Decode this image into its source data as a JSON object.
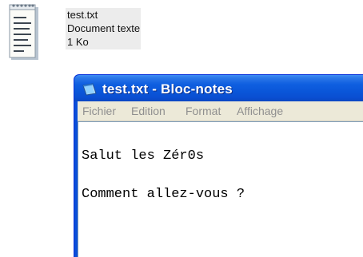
{
  "desktop_file": {
    "icon": "text-document-icon",
    "name": "test.txt",
    "type": "Document texte",
    "size": "1 Ko"
  },
  "notepad": {
    "title": "test.txt - Bloc-notes",
    "title_icon": "notepad-icon",
    "menu": {
      "file": "Fichier",
      "edit": "Edition",
      "format": "Format",
      "view": "Affichage"
    },
    "content_lines": [
      "Salut les Zér0s",
      "Comment allez-vous ?"
    ]
  },
  "colors": {
    "titlebar": "#0a55d8",
    "menubar": "#ece9d8",
    "menu_text_disabled": "#8f8f8f"
  }
}
